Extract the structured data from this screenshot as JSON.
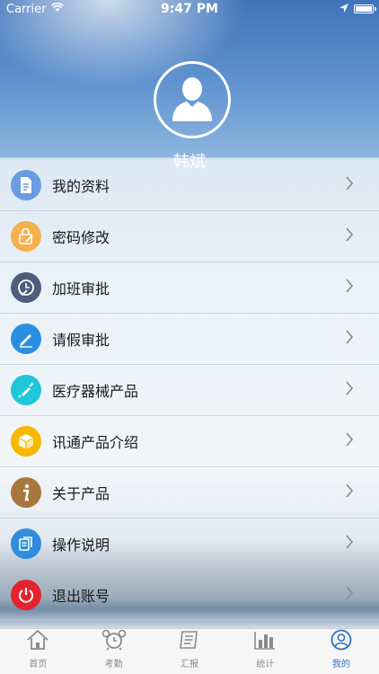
{
  "status_bar": {
    "carrier": "Carrier",
    "time": "9:47 PM"
  },
  "profile": {
    "name": "韩斌"
  },
  "menu": [
    {
      "label": "我的资料",
      "icon": "document-icon",
      "color": "#6b9be0"
    },
    {
      "label": "密码修改",
      "icon": "lock-edit-icon",
      "color": "#f5b04f"
    },
    {
      "label": "加班审批",
      "icon": "clock-check-icon",
      "color": "#4c5e7a"
    },
    {
      "label": "请假审批",
      "icon": "pen-icon",
      "color": "#2a8fe0"
    },
    {
      "label": "医疗器械产品",
      "icon": "syringe-icon",
      "color": "#1fc6d8"
    },
    {
      "label": "讯通产品介绍",
      "icon": "box-icon",
      "color": "#f6b800"
    },
    {
      "label": "关于产品",
      "icon": "info-icon",
      "color": "#a8773e"
    },
    {
      "label": "操作说明",
      "icon": "pages-icon",
      "color": "#2f8ddc"
    },
    {
      "label": "退出账号",
      "icon": "power-icon",
      "color": "#e5232c"
    }
  ],
  "tabs": [
    {
      "label": "首页",
      "icon": "home-icon",
      "active": false
    },
    {
      "label": "考勤",
      "icon": "alarm-clock-icon",
      "active": false
    },
    {
      "label": "汇报",
      "icon": "report-icon",
      "active": false
    },
    {
      "label": "统计",
      "icon": "bar-chart-icon",
      "active": false
    },
    {
      "label": "我的",
      "icon": "user-icon",
      "active": true
    }
  ],
  "colors": {
    "accent": "#2e74c5",
    "inactive": "#8a8a8a"
  }
}
